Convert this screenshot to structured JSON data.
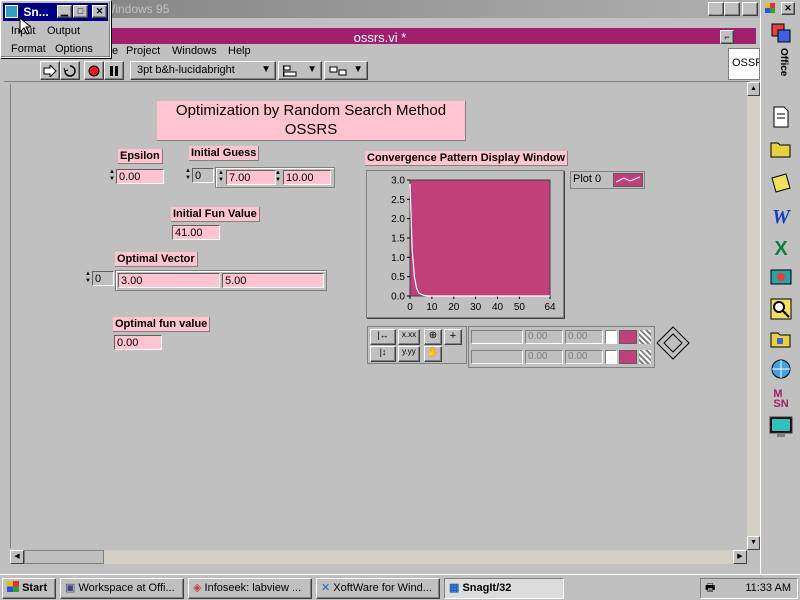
{
  "os_window_title": "Windows 95",
  "vi_title": "ossrs.vi *",
  "menu": {
    "project": "Project",
    "windows": "Windows",
    "help": "Help",
    "partial": "e"
  },
  "toolbar": {
    "font_selector": "3pt b&h-lucidabright"
  },
  "panel": {
    "title_line1": "Optimization by Random Search Method",
    "title_line2": "OSSRS",
    "epsilon_label": "Epsilon",
    "epsilon_value": "0.00",
    "initial_guess_label": "Initial Guess",
    "initial_guess_index": "0",
    "initial_guess_values": [
      "7.00",
      "10.00"
    ],
    "initial_fun_label": "Initial Fun Value",
    "initial_fun_value": "41.00",
    "optimal_vector_label": "Optimal Vector",
    "optimal_vector_index": "0",
    "optimal_vector_values": [
      "3.00",
      "5.00"
    ],
    "optimal_fun_label": "Optimal fun value",
    "optimal_fun_value": "0.00",
    "chart_title": "Convergence Pattern Display Window",
    "legend_label": "Plot 0",
    "cursor_rows": [
      {
        "x": "0.00",
        "y": "0.00"
      },
      {
        "x": "0.00",
        "y": "0.00"
      }
    ],
    "format_x": "x.xx",
    "format_y": "y.yy"
  },
  "chart_data": {
    "type": "line",
    "title": "Convergence Pattern Display Window",
    "x": [
      0,
      1,
      2,
      3,
      4,
      6,
      8,
      64
    ],
    "series": [
      {
        "name": "Plot 0",
        "values": [
          2.9,
          1.2,
          0.5,
          0.2,
          0.08,
          0.02,
          0.0,
          0.0
        ]
      }
    ],
    "xlim": [
      0,
      64
    ],
    "ylim": [
      0,
      3
    ],
    "xticks": [
      0,
      10,
      20,
      30,
      40,
      50,
      64
    ],
    "yticks": [
      0.0,
      0.5,
      1.0,
      1.5,
      2.0,
      2.5,
      3.0
    ],
    "xlabel": "",
    "ylabel": "",
    "plot_bg": "#c0407a",
    "line_color": "#ffffff"
  },
  "colors": {
    "vi_title_bg": "#a0206e",
    "label_bg": "#ffc4d0",
    "taskbar_bg": "#c0c0c0",
    "plot_bg": "#c0407a"
  },
  "snagit": {
    "title": "Sn...",
    "menu": [
      "Input",
      "Output",
      "Format",
      "Options"
    ]
  },
  "side_tab": "OSSF",
  "officebar_label": "Office",
  "taskbar": {
    "start": "Start",
    "tasks": [
      "Workspace at Offi...",
      "Infoseek: labview ...",
      "XoftWare for Wind...",
      "SnagIt/32"
    ],
    "clock": "11:33 AM"
  }
}
